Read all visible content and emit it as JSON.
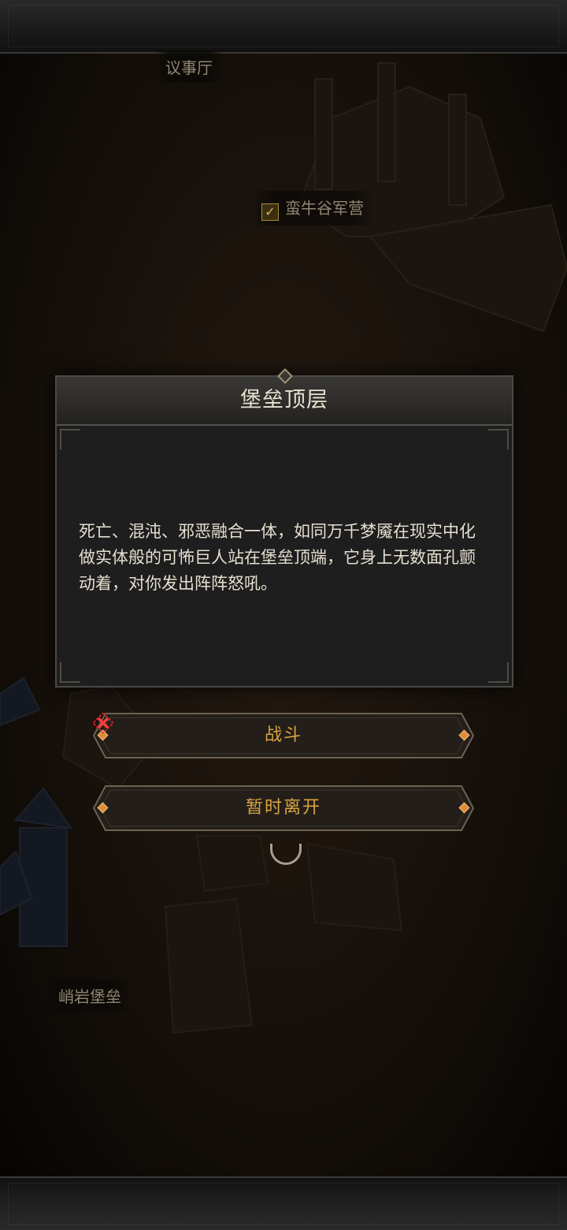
{
  "map": {
    "labels": {
      "council_hall": "议事厅",
      "camp": "蛮牛谷军营",
      "fortress": "峭岩堡垒"
    }
  },
  "dialog": {
    "title": "堡垒顶层",
    "body": "死亡、混沌、邪恶融合一体，如同万千梦魇在现实中化做实体般的可怖巨人站在堡垒顶端，它身上无数面孔颤动着，对你发出阵阵怒吼。"
  },
  "actions": {
    "fight": "战斗",
    "leave": "暂时离开"
  },
  "icons": {
    "check": "check-icon",
    "close": "close-x-icon"
  },
  "colors": {
    "accent": "#d9a342",
    "dialog_bg": "#1e1e1f",
    "close_red": "#d8222a"
  }
}
